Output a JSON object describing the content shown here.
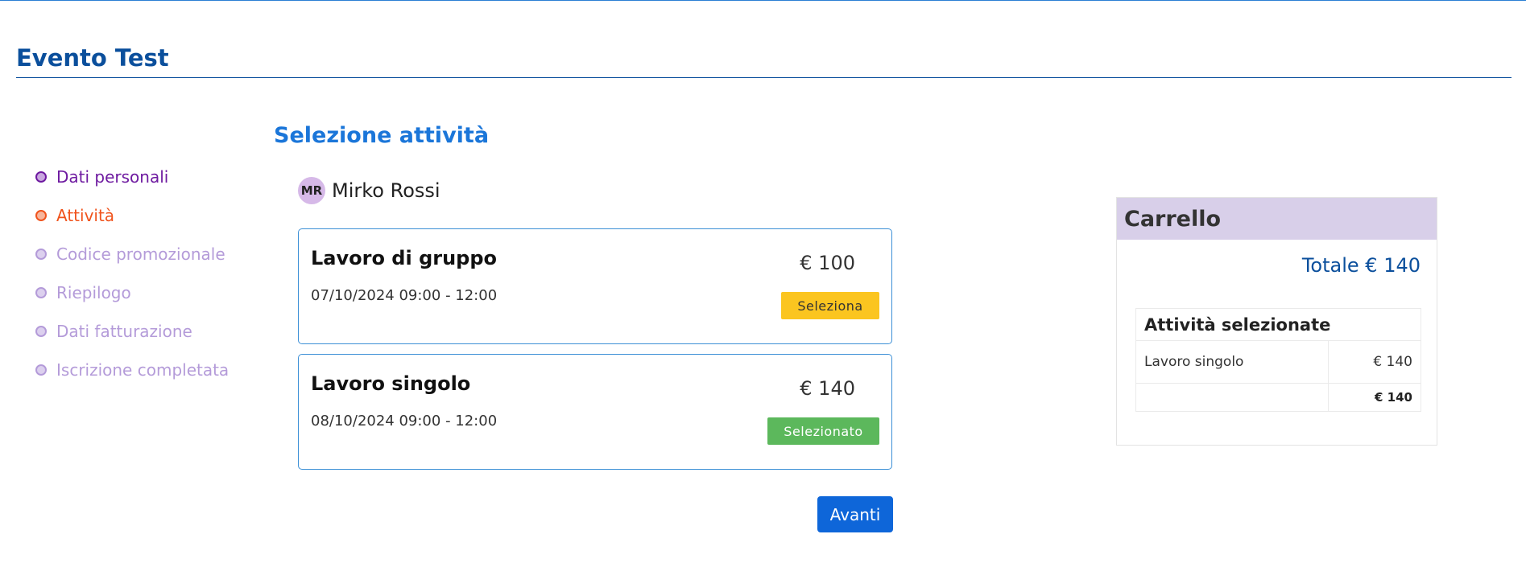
{
  "event": {
    "title": "Evento Test"
  },
  "steps": [
    {
      "label": "Dati personali",
      "state": "done"
    },
    {
      "label": "Attività",
      "state": "active"
    },
    {
      "label": "Codice promozionale",
      "state": "pending"
    },
    {
      "label": "Riepilogo",
      "state": "pending"
    },
    {
      "label": "Dati fatturazione",
      "state": "pending"
    },
    {
      "label": "Iscrizione completata",
      "state": "pending"
    }
  ],
  "main": {
    "title": "Selezione attività",
    "participant": {
      "initials": "MR",
      "name": "Mirko Rossi"
    },
    "activities": [
      {
        "name": "Lavoro di gruppo",
        "date": "07/10/2024 09:00 - 12:00",
        "price": "€ 100",
        "button_label": "Seleziona",
        "selected": false
      },
      {
        "name": "Lavoro singolo",
        "date": "08/10/2024 09:00 - 12:00",
        "price": "€ 140",
        "button_label": "Selezionato",
        "selected": true
      }
    ],
    "next_label": "Avanti"
  },
  "cart": {
    "title": "Carrello",
    "total": "Totale € 140",
    "table_header": "Attività selezionate",
    "items": [
      {
        "name": "Lavoro singolo",
        "amount": "€ 140"
      }
    ],
    "sum": "€ 140"
  },
  "colors": {
    "brand_blue": "#0b4f9c",
    "accent_blue": "#1b76d9",
    "step_done": "#6e1aa0",
    "step_active": "#f0531c",
    "step_pending": "#b49bd9",
    "select_button": "#fbc520",
    "selected_button": "#5cb85c",
    "cart_header": "#d8cfe9"
  }
}
